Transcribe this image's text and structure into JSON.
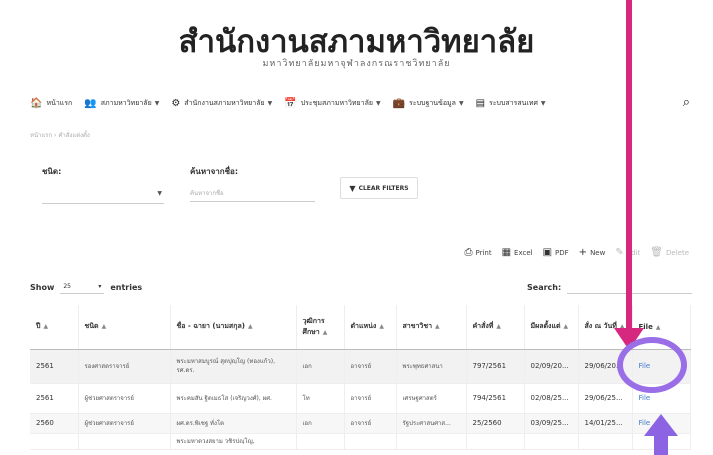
{
  "header": {
    "title": "สำนักงานสภามหาวิทยาลัย",
    "subtitle": "มหาวิทยาลัยมหาจุฬาลงกรณราชวิทยาลัย"
  },
  "nav": {
    "items": [
      {
        "label": "หน้าแรก",
        "icon": "home-icon",
        "glyph": "🏠",
        "dropdown": false
      },
      {
        "label": "สภามหาวิทยาลัย",
        "icon": "people-icon",
        "glyph": "👥",
        "dropdown": true
      },
      {
        "label": "สำนักงานสภามหาวิทยาลัย",
        "icon": "gear-icon",
        "glyph": "⚙",
        "dropdown": true
      },
      {
        "label": "ประชุมสภามหาวิทยาลัย",
        "icon": "calendar-icon",
        "glyph": "📅",
        "dropdown": true
      },
      {
        "label": "ระบบฐานข้อมูล",
        "icon": "briefcase-icon",
        "glyph": "💼",
        "dropdown": true
      },
      {
        "label": "ระบบสารสนเทศ",
        "icon": "document-icon",
        "glyph": "▤",
        "dropdown": true
      }
    ]
  },
  "breadcrumb": "หน้าแรก › คำสั่งแต่งตั้ง",
  "filters": {
    "type_label": "ชนิด:",
    "search_label": "ค้นหาจากชื่อ:",
    "search_placeholder": "ค้นหาจากชื่อ",
    "clear_label": "CLEAR FILTERS"
  },
  "toolbar": {
    "print": "Print",
    "excel": "Excel",
    "pdf": "PDF",
    "new": "New",
    "edit": "Edit",
    "delete": "Delete"
  },
  "table_controls": {
    "show": "Show",
    "page_length": "25",
    "entries": "entries",
    "search": "Search:"
  },
  "table": {
    "headers": [
      "ปี",
      "ชนิด",
      "ชื่อ - ฉายา (นามสกุล)",
      "วุฒิการศึกษา",
      "ตำแหน่ง",
      "สาขาวิชา",
      "คำสั่งที่",
      "มีผลตั้งแต่",
      "สั่ง ณ วันที่",
      "File"
    ],
    "rows": [
      [
        "2561",
        "รองศาสตราจารย์",
        "พระมหาสมบูรณ์ สุตปุญฺโญ (ทองแก้ว), รศ.ดร.",
        "เอก",
        "อาจารย์",
        "พระพุทธศาสนา",
        "797/2561",
        "02/09/20...",
        "29/06/20...",
        "File"
      ],
      [
        "2561",
        "ผู้ช่วยศาสตราจารย์",
        "พระคมสัน ฐิตเมธโส (เจริญวงศ์), ผศ.",
        "โท",
        "อาจารย์",
        "เศรษฐศาสตร์",
        "794/2561",
        "02/08/25...",
        "29/06/25...",
        "File"
      ],
      [
        "2560",
        "ผู้ช่วยศาสตราจารย์",
        "ผศ.ดร.พิเชฐ ทั่งโต",
        "เอก",
        "อาจารย์",
        "รัฐประศาสนศาส...",
        "25/2560",
        "03/09/25...",
        "14/01/25...",
        "File"
      ],
      [
        "",
        "",
        "พระมหาดวงสยาม วชิรปญฺโญ,",
        "",
        "",
        "",
        "",
        "",
        "",
        ""
      ]
    ]
  },
  "annotations": {
    "pointer_arrow_color": "#d6287f",
    "highlight_color": "#9a6ee6"
  }
}
